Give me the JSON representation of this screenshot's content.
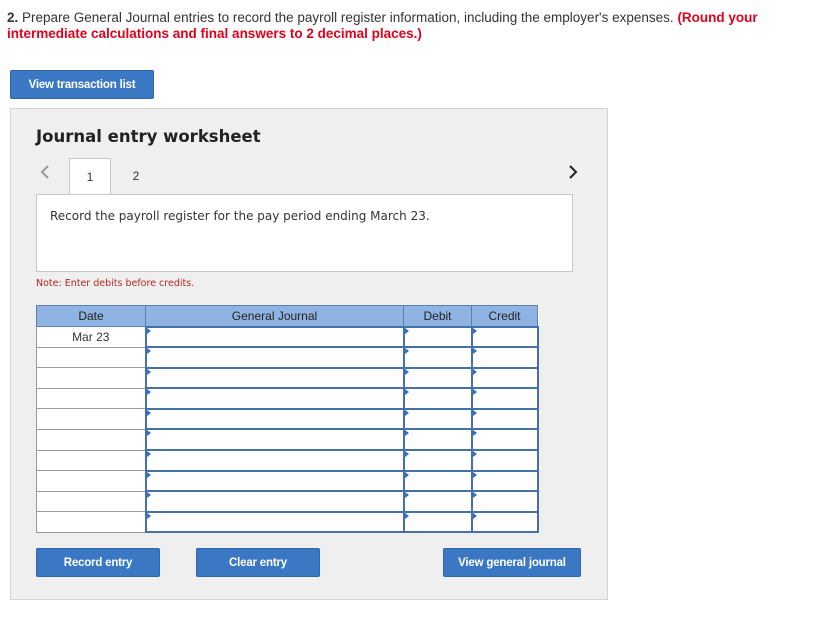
{
  "question": {
    "number": "2.",
    "text": " Prepare General Journal entries to record the payroll register information, including the employer's expenses. ",
    "emphasis": "(Round your intermediate calculations and final answers to 2 decimal places.)"
  },
  "buttons": {
    "view_transactions": "View transaction list",
    "record_entry": "Record entry",
    "clear_entry": "Clear entry",
    "view_general_journal": "View general journal"
  },
  "worksheet": {
    "title": "Journal entry worksheet",
    "tabs": [
      "1",
      "2"
    ],
    "description": "Record the payroll register for the pay period ending March 23.",
    "note": "Note: Enter debits before credits."
  },
  "table": {
    "headers": [
      "Date",
      "General Journal",
      "Debit",
      "Credit"
    ],
    "rows": [
      {
        "date": "Mar 23",
        "account": "",
        "debit": "",
        "credit": ""
      },
      {
        "date": "",
        "account": "",
        "debit": "",
        "credit": ""
      },
      {
        "date": "",
        "account": "",
        "debit": "",
        "credit": ""
      },
      {
        "date": "",
        "account": "",
        "debit": "",
        "credit": ""
      },
      {
        "date": "",
        "account": "",
        "debit": "",
        "credit": ""
      },
      {
        "date": "",
        "account": "",
        "debit": "",
        "credit": ""
      },
      {
        "date": "",
        "account": "",
        "debit": "",
        "credit": ""
      },
      {
        "date": "",
        "account": "",
        "debit": "",
        "credit": ""
      },
      {
        "date": "",
        "account": "",
        "debit": "",
        "credit": ""
      },
      {
        "date": "",
        "account": "",
        "debit": "",
        "credit": ""
      }
    ]
  },
  "icons": {
    "prev": "chevron-left-icon",
    "next": "chevron-right-icon"
  },
  "colors": {
    "button": "#3b78c3",
    "header": "#8fb4e3",
    "emphasis": "#e3001b",
    "note": "#b5271f"
  }
}
